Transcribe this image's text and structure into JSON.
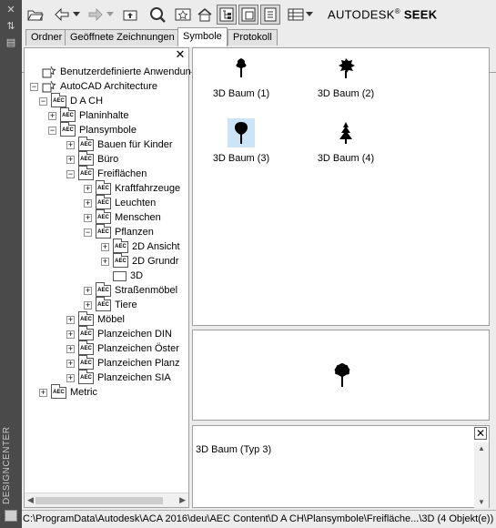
{
  "side_palette": {
    "title": "DESIGNCENTER",
    "buttons": [
      "close-icon",
      "pin-icon",
      "properties-icon"
    ]
  },
  "toolbar": {
    "buttons": [
      "open-folder-icon",
      "back-icon",
      "back-dropdown-icon",
      "forward-icon",
      "forward-dropdown-icon",
      "up-icon",
      "search-icon",
      "favorites-icon",
      "home-icon",
      "tree-view-toggle-icon",
      "preview-toggle-icon",
      "description-toggle-icon",
      "views-icon",
      "views-dropdown-icon"
    ],
    "brand_prefix": "AUTODESK",
    "brand_reg": "®",
    "brand_suffix": "SEEK"
  },
  "tabs": [
    {
      "label": "Ordner"
    },
    {
      "label": "Geöffnete Zeichnungen"
    },
    {
      "label": "Symbole",
      "active": true
    },
    {
      "label": "Protokoll"
    }
  ],
  "tree": {
    "rows": [
      {
        "label": "Benutzerdefinierte Anwendungen",
        "level": 0,
        "expander": "none",
        "icon": "custom-apps-icon"
      },
      {
        "label": "AutoCAD Architecture",
        "level": 0,
        "expander": "minus",
        "icon": "custom-apps-icon"
      },
      {
        "label": "D A CH",
        "level": 1,
        "expander": "minus",
        "icon": "aec-folder-icon"
      },
      {
        "label": "Planinhalte",
        "level": 2,
        "expander": "plus",
        "icon": "aec-folder-icon"
      },
      {
        "label": "Plansymbole",
        "level": 2,
        "expander": "minus",
        "icon": "aec-folder-icon"
      },
      {
        "label": "Bauen für Kinder",
        "level": 3,
        "expander": "plus",
        "icon": "aec-folder-icon"
      },
      {
        "label": "Büro",
        "level": 3,
        "expander": "plus",
        "icon": "aec-folder-icon"
      },
      {
        "label": "Freiflächen",
        "level": 3,
        "expander": "minus",
        "icon": "aec-folder-icon"
      },
      {
        "label": "Kraftfahrzeuge",
        "level": 4,
        "expander": "plus",
        "icon": "aec-folder-icon"
      },
      {
        "label": "Leuchten",
        "level": 4,
        "expander": "plus",
        "icon": "aec-folder-icon"
      },
      {
        "label": "Menschen",
        "level": 4,
        "expander": "plus",
        "icon": "aec-folder-icon"
      },
      {
        "label": "Pflanzen",
        "level": 4,
        "expander": "minus",
        "icon": "aec-folder-icon"
      },
      {
        "label": "2D Ansicht",
        "level": 5,
        "expander": "plus",
        "icon": "aec-folder-icon"
      },
      {
        "label": "2D Grundr",
        "level": 5,
        "expander": "plus",
        "icon": "aec-folder-icon"
      },
      {
        "label": "3D",
        "level": 5,
        "expander": "none",
        "icon": "folder-icon"
      },
      {
        "label": "Straßenmöbel",
        "level": 4,
        "expander": "plus",
        "icon": "aec-folder-icon"
      },
      {
        "label": "Tiere",
        "level": 4,
        "expander": "plus",
        "icon": "aec-folder-icon"
      },
      {
        "label": "Möbel",
        "level": 3,
        "expander": "plus",
        "icon": "aec-folder-icon"
      },
      {
        "label": "Planzeichen DIN",
        "level": 3,
        "expander": "plus",
        "icon": "aec-folder-icon"
      },
      {
        "label": "Planzeichen Öster",
        "level": 3,
        "expander": "plus",
        "icon": "aec-folder-icon"
      },
      {
        "label": "Planzeichen Planz",
        "level": 3,
        "expander": "plus",
        "icon": "aec-folder-icon"
      },
      {
        "label": "Planzeichen SIA",
        "level": 3,
        "expander": "plus",
        "icon": "aec-folder-icon"
      },
      {
        "label": "Metric",
        "level": 1,
        "expander": "plus",
        "icon": "aec-folder-icon"
      }
    ]
  },
  "content": {
    "items": [
      {
        "label": "3D Baum (1)",
        "icon": "tree-symbol-1-icon"
      },
      {
        "label": "3D Baum (2)",
        "icon": "tree-symbol-2-icon"
      },
      {
        "label": "3D Baum (3)",
        "icon": "tree-symbol-3-icon",
        "selected": true
      },
      {
        "label": "3D Baum (4)",
        "icon": "conifer-symbol-icon"
      }
    ]
  },
  "preview": {
    "icon": "tree-symbol-3-preview-icon"
  },
  "description": {
    "text": "3D Baum (Typ 3)"
  },
  "status": {
    "path": "C:\\ProgramData\\Autodesk\\ACA 2016\\deu\\AEC Content\\D A CH\\Plansymbole\\Freifläche...\\3D (4 Objekt(e))"
  }
}
